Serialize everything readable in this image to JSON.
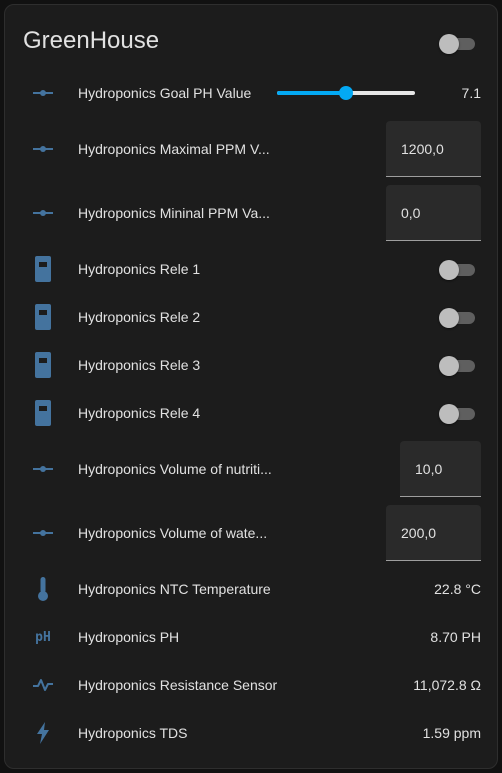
{
  "card": {
    "title": "GreenHouse",
    "header_toggle_on": false
  },
  "colors": {
    "icon": "#44739e",
    "accent": "#03a9f4",
    "card_bg": "#1c1c1c",
    "text": "#e1e1e1"
  },
  "rows": {
    "ph_goal": {
      "label": "Hydroponics Goal PH Value",
      "value": "7.1",
      "slider_fraction": 0.5,
      "icon": "slider-icon"
    },
    "ppm_max": {
      "label": "Hydroponics Maximal PPM V...",
      "value": "1200,0",
      "icon": "slider-icon"
    },
    "ppm_min": {
      "label": "Hydroponics Mininal PPM Va...",
      "value": "0,0",
      "icon": "slider-icon"
    },
    "rele1": {
      "label": "Hydroponics Rele 1",
      "on": false,
      "icon": "relay-icon"
    },
    "rele2": {
      "label": "Hydroponics Rele 2",
      "on": false,
      "icon": "relay-icon"
    },
    "rele3": {
      "label": "Hydroponics Rele 3",
      "on": false,
      "icon": "relay-icon"
    },
    "rele4": {
      "label": "Hydroponics Rele 4",
      "on": false,
      "icon": "relay-icon"
    },
    "vol_nutri": {
      "label": "Hydroponics Volume of nutriti...",
      "value": "10,0",
      "icon": "slider-icon"
    },
    "vol_water": {
      "label": "Hydroponics Volume of wate...",
      "value": "200,0",
      "icon": "slider-icon"
    },
    "ntc": {
      "label": "Hydroponics NTC Temperature",
      "value": "22.8 °C",
      "icon": "thermometer-icon"
    },
    "ph": {
      "label": "Hydroponics PH",
      "value": "8.70 PH",
      "icon": "ph-icon",
      "icon_text": "pH"
    },
    "resistance": {
      "label": "Hydroponics Resistance Sensor",
      "value": "11,072.8 Ω",
      "icon": "pulse-icon"
    },
    "tds": {
      "label": "Hydroponics TDS",
      "value": "1.59 ppm",
      "icon": "flash-icon"
    }
  }
}
